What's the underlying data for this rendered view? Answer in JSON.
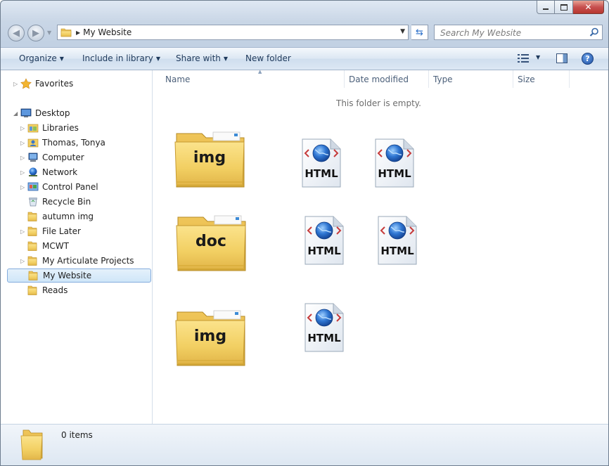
{
  "window": {
    "caption_buttons": {
      "minimize": "minimize",
      "maximize": "maximize",
      "close": "close"
    }
  },
  "navbar": {
    "address_path": "My Website",
    "search_placeholder": "Search My Website"
  },
  "commandbar": {
    "organize": "Organize",
    "include_in_library": "Include in library",
    "share_with": "Share with",
    "new_folder": "New folder"
  },
  "navpane": {
    "favorites": "Favorites",
    "desktop": "Desktop",
    "items": [
      {
        "label": "Libraries",
        "icon": "libraries-icon",
        "expandable": true
      },
      {
        "label": "Thomas, Tonya",
        "icon": "user-icon",
        "expandable": true
      },
      {
        "label": "Computer",
        "icon": "computer-icon",
        "expandable": true
      },
      {
        "label": "Network",
        "icon": "network-icon",
        "expandable": true
      },
      {
        "label": "Control Panel",
        "icon": "control-panel-icon",
        "expandable": true
      },
      {
        "label": "Recycle Bin",
        "icon": "recycle-bin-icon",
        "expandable": false
      },
      {
        "label": "autumn img",
        "icon": "folder-icon",
        "expandable": false
      },
      {
        "label": "File Later",
        "icon": "folder-icon",
        "expandable": true
      },
      {
        "label": "MCWT",
        "icon": "folder-icon",
        "expandable": false
      },
      {
        "label": "My Articulate Projects",
        "icon": "folder-icon",
        "expandable": true
      },
      {
        "label": "My Website",
        "icon": "folder-icon",
        "expandable": false,
        "selected": true
      },
      {
        "label": "Reads",
        "icon": "folder-icon",
        "expandable": false
      }
    ]
  },
  "columns": {
    "name": "Name",
    "date_modified": "Date modified",
    "type": "Type",
    "size": "Size"
  },
  "content": {
    "empty_message": "This folder is empty.",
    "folders": [
      {
        "label": "img"
      },
      {
        "label": "doc"
      },
      {
        "label": "img"
      }
    ],
    "html_files": [
      {
        "label": "HTML"
      },
      {
        "label": "HTML"
      },
      {
        "label": "HTML"
      },
      {
        "label": "HTML"
      },
      {
        "label": "HTML"
      }
    ]
  },
  "details": {
    "item_count": "0 items"
  },
  "colors": {
    "folder_yellow": "#f2cf62",
    "folder_dark": "#d9ae3c",
    "globe_blue": "#1f5fb8",
    "selection_border": "#84acdd",
    "command_text": "#1e395b"
  }
}
